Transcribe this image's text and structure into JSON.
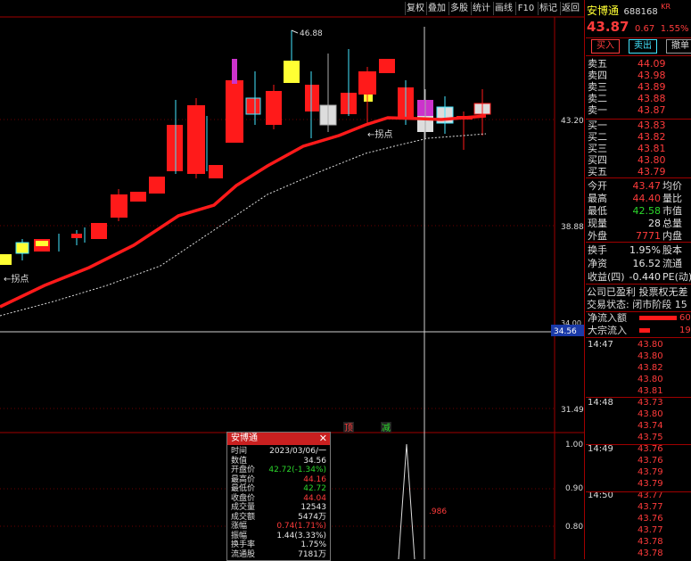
{
  "toolbar": [
    "复权",
    "叠加",
    "多股",
    "统计",
    "画线",
    "F10",
    "标记",
    "返回"
  ],
  "stock": {
    "name": "安博通",
    "code": "688168",
    "suffix": "KR",
    "price": "43.87",
    "change": "0.67",
    "change_pct": "1.55%"
  },
  "trade_buttons": {
    "buy": "买入",
    "sell": "卖出",
    "cancel": "撤单"
  },
  "order_book": {
    "asks": [
      {
        "label": "卖五",
        "price": "44.09"
      },
      {
        "label": "卖四",
        "price": "43.98"
      },
      {
        "label": "卖三",
        "price": "43.89"
      },
      {
        "label": "卖二",
        "price": "43.88"
      },
      {
        "label": "卖一",
        "price": "43.87"
      }
    ],
    "bids": [
      {
        "label": "买一",
        "price": "43.83"
      },
      {
        "label": "买二",
        "price": "43.82"
      },
      {
        "label": "买三",
        "price": "43.81"
      },
      {
        "label": "买四",
        "price": "43.80"
      },
      {
        "label": "买五",
        "price": "43.79"
      }
    ]
  },
  "quote": [
    {
      "label": "今开",
      "value": "43.47",
      "tag": "均价",
      "color": "red"
    },
    {
      "label": "最高",
      "value": "44.40",
      "tag": "量比",
      "color": "red"
    },
    {
      "label": "最低",
      "value": "42.58",
      "tag": "市值",
      "color": "green"
    },
    {
      "label": "现量",
      "value": "28",
      "tag": "总量",
      "color": "white"
    },
    {
      "label": "外盘",
      "value": "7771",
      "tag": "内盘",
      "color": "red"
    }
  ],
  "stats": [
    {
      "label": "换手",
      "value": "1.95%",
      "tag": "股本"
    },
    {
      "label": "净资",
      "value": "16.52",
      "tag": "流通"
    },
    {
      "label": "收益(四)",
      "value": "-0.440",
      "tag": "PE(动)"
    }
  ],
  "status": {
    "line1": "公司已盈利 投票权无差",
    "line2": "交易状态: 闭市阶段 15"
  },
  "flows": [
    {
      "label": "净流入额",
      "value": "60"
    },
    {
      "label": "大宗流入",
      "value": "19"
    }
  ],
  "ticks": [
    {
      "time": "14:47",
      "price": "43.80"
    },
    {
      "time": "",
      "price": "43.80"
    },
    {
      "time": "",
      "price": "43.82"
    },
    {
      "time": "",
      "price": "43.80"
    },
    {
      "time": "",
      "price": "43.81"
    },
    {
      "time": "14:48",
      "price": "43.73"
    },
    {
      "time": "",
      "price": "43.80"
    },
    {
      "time": "",
      "price": "43.74"
    },
    {
      "time": "",
      "price": "43.75"
    },
    {
      "time": "14:49",
      "price": "43.76"
    },
    {
      "time": "",
      "price": "43.76"
    },
    {
      "time": "",
      "price": "43.79"
    },
    {
      "time": "",
      "price": "43.79"
    },
    {
      "time": "14:50",
      "price": "43.77"
    },
    {
      "time": "",
      "price": "43.77"
    },
    {
      "time": "",
      "price": "43.76"
    },
    {
      "time": "",
      "price": "43.77"
    },
    {
      "time": "",
      "price": "43.78"
    },
    {
      "time": "",
      "price": "43.78"
    }
  ],
  "chart": {
    "price_axis": [
      "43.20",
      "38.88",
      "34.00",
      "31.49"
    ],
    "cursor_price": "34.56",
    "high_label": "46.88",
    "annotations": [
      "←拐点",
      "←拐点"
    ],
    "markers": [
      "顶",
      "减"
    ],
    "sub_axis": [
      "1.00",
      "0.90",
      "0.80"
    ],
    "sub_value": ".986"
  },
  "info_box": {
    "title": "安博通",
    "rows": [
      {
        "label": "时间",
        "value": "2023/03/06/一",
        "color": "white"
      },
      {
        "label": "数值",
        "value": "34.56",
        "color": "white"
      },
      {
        "label": "开盘价",
        "value": "42.72(-1.34%)",
        "color": "green"
      },
      {
        "label": "最高价",
        "value": "44.16",
        "color": "red"
      },
      {
        "label": "最低价",
        "value": "42.72",
        "color": "green"
      },
      {
        "label": "收盘价",
        "value": "44.04",
        "color": "red"
      },
      {
        "label": "成交量",
        "value": "12543",
        "color": "white"
      },
      {
        "label": "成交额",
        "value": "5474万",
        "color": "white"
      },
      {
        "label": "涨幅",
        "value": "0.74(1.71%)",
        "color": "red"
      },
      {
        "label": "振幅",
        "value": "1.44(3.33%)",
        "color": "white"
      },
      {
        "label": "换手率",
        "value": "1.75%",
        "color": "white"
      },
      {
        "label": "流通股",
        "value": "7181万",
        "color": "white"
      }
    ]
  }
}
